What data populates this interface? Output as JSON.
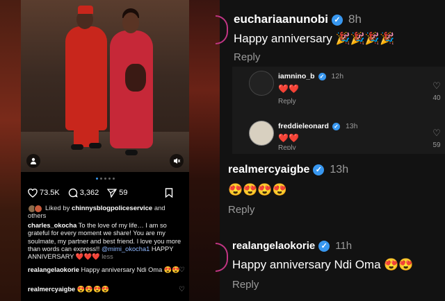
{
  "post": {
    "likes": "73.5K",
    "comments": "3,362",
    "shares": "59",
    "liked_by_prefix": "Liked by ",
    "liked_by_user": "chinnysblogpoliceservice",
    "liked_by_suffix": " and others",
    "caption_user": "charles_okocha",
    "caption_text": " To the love of my life… I am so grateful for every moment we share! You are my soulmate, my partner and best friend. I love you more than words can express!! ",
    "caption_mention": "@mimi_okocha1",
    "caption_tail": " HAPPY ANNIVERSARY ❤️❤️❤️ ",
    "caption_less": "less",
    "comment1_user": "realangelaokorie",
    "comment1_text": " Happy anniversary Ndi Oma 😍😍",
    "comment2_user": "realmercyaigbe",
    "comment2_text": " 😍😍😍😍"
  },
  "comments": {
    "c1": {
      "user": "eucharia​anunobi",
      "time": "8h",
      "text": "Happy anniversary 🎉🎉🎉🎉",
      "reply": "Reply"
    },
    "r1": {
      "user": "iamnino_b",
      "time": "12h",
      "text": "❤️❤️",
      "reply": "Reply",
      "likes": "40"
    },
    "r2": {
      "user": "freddieleonard",
      "time": "13h",
      "text": "❤️❤️",
      "reply": "Reply",
      "likes": "59"
    },
    "c2": {
      "user": "realmercyaigbe",
      "time": "13h",
      "text": "😍😍😍😍",
      "reply": "Reply"
    },
    "c3": {
      "user": "realangelaokorie",
      "time": "11h",
      "text": "Happy anniversary Ndi Oma 😍😍",
      "reply": "Reply"
    }
  },
  "colors": {
    "verified": "#3897f0",
    "background": "#121212",
    "ring": "#c13584"
  }
}
